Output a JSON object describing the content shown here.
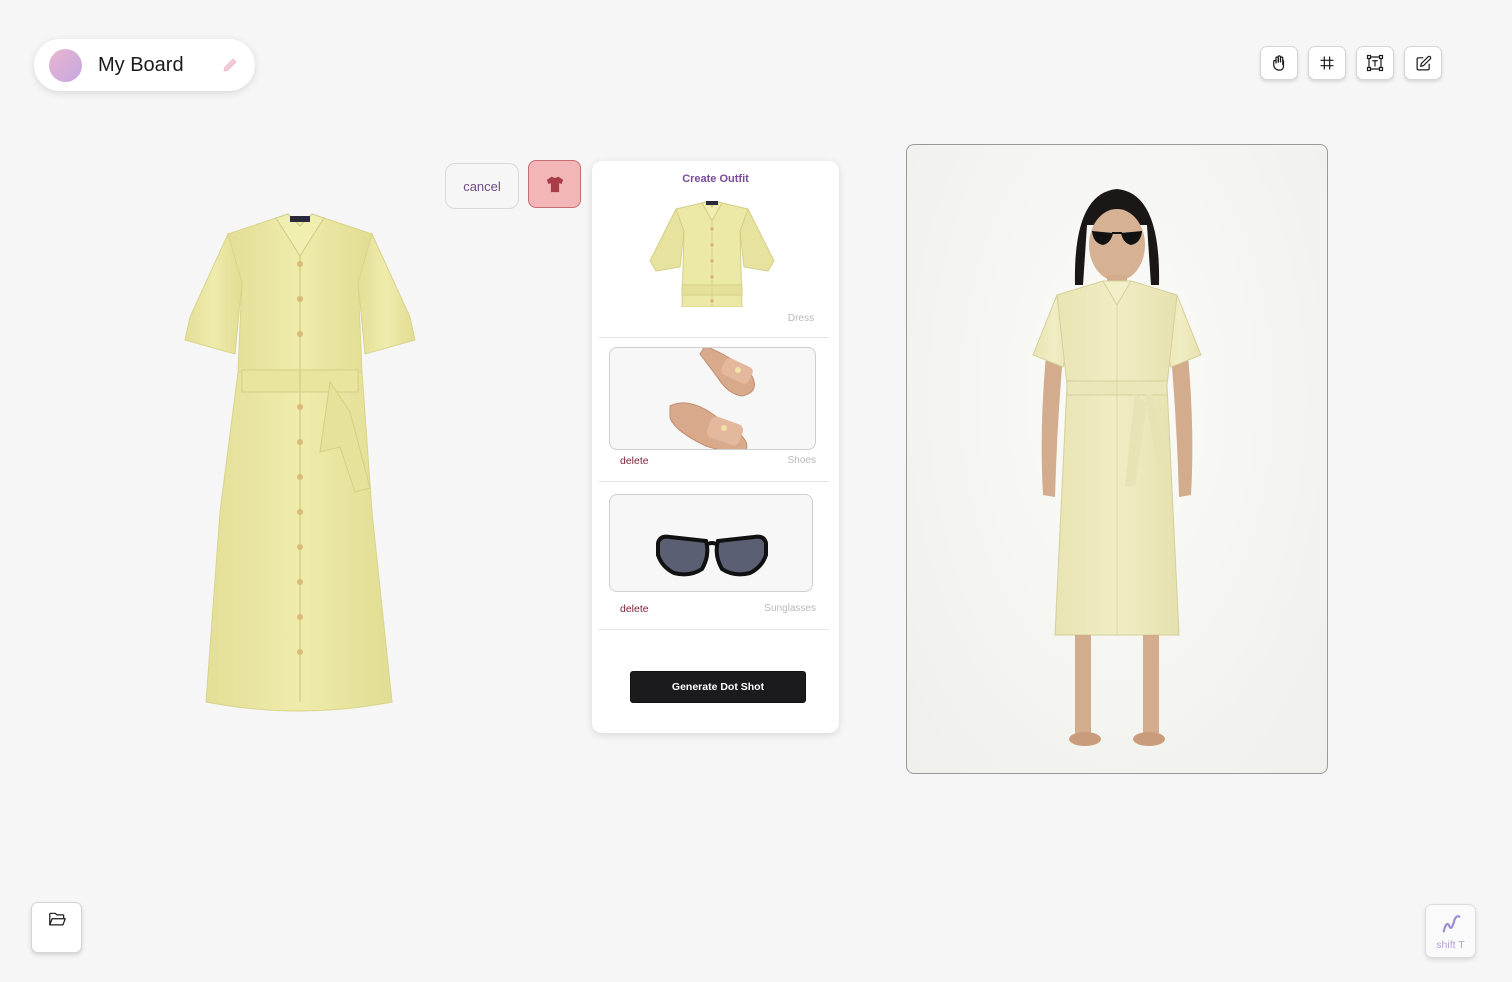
{
  "board": {
    "title": "My Board",
    "edit_icon": "pencil-icon"
  },
  "toolbar": {
    "tools": [
      {
        "name": "hand-icon"
      },
      {
        "name": "frame-icon"
      },
      {
        "name": "text-box-icon"
      },
      {
        "name": "edit-icon"
      }
    ]
  },
  "actions": {
    "cancel_label": "cancel",
    "shirt_icon": "tshirt-icon"
  },
  "outfit": {
    "title": "Create Outfit",
    "items": [
      {
        "category": "Dress"
      },
      {
        "category": "Shoes",
        "delete_label": "delete"
      },
      {
        "category": "Sunglasses",
        "delete_label": "delete"
      }
    ],
    "generate_label": "Generate Dot Shot"
  },
  "bottom": {
    "folder_icon": "folder-open-icon",
    "shortcut_label": "shift T"
  },
  "colors": {
    "background": "#f6f6f6",
    "accent_purple": "#7a4a9a",
    "delete_red": "#7a1f34",
    "shirt_button_fill": "#f2b6b9",
    "dress_yellow": "#eceaa6"
  }
}
